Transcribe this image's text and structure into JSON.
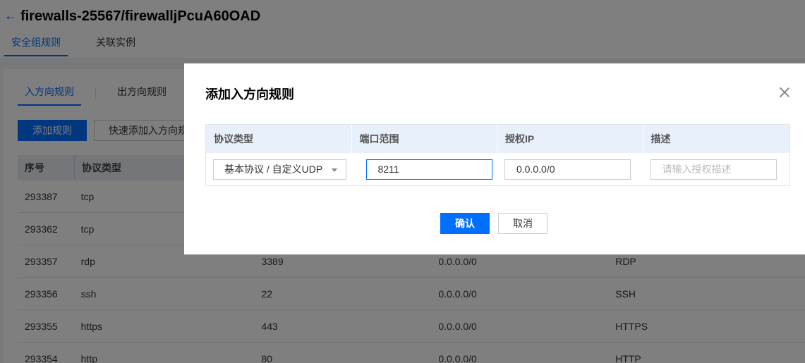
{
  "header": {
    "title": "firewalls-25567/firewalljPcuA60OAD",
    "back_icon": "←",
    "tabs": [
      {
        "label": "安全组规则"
      },
      {
        "label": "关联实例"
      }
    ]
  },
  "rules": {
    "sub_tabs": [
      {
        "label": "入方向规则"
      },
      {
        "label": "出方向规则"
      }
    ],
    "add_button": "添加规则",
    "quick_add_button": "快速添加入方向规",
    "columns": [
      "序号",
      "协议类型"
    ],
    "rows": [
      {
        "id": "293387",
        "protocol": "tcp",
        "port": "",
        "ip": "",
        "desc": ""
      },
      {
        "id": "293362",
        "protocol": "tcp",
        "port": "",
        "ip": "",
        "desc": ""
      },
      {
        "id": "293357",
        "protocol": "rdp",
        "port": "3389",
        "ip": "0.0.0.0/0",
        "desc": "RDP"
      },
      {
        "id": "293356",
        "protocol": "ssh",
        "port": "22",
        "ip": "0.0.0.0/0",
        "desc": "SSH"
      },
      {
        "id": "293355",
        "protocol": "https",
        "port": "443",
        "ip": "0.0.0.0/0",
        "desc": "HTTPS"
      },
      {
        "id": "293354",
        "protocol": "http",
        "port": "80",
        "ip": "0.0.0.0/0",
        "desc": "HTTP"
      }
    ]
  },
  "modal": {
    "title": "添加入方向规则",
    "columns": [
      "协议类型",
      "端口范围",
      "授权IP",
      "描述"
    ],
    "protocol_value": "基本协议 / 自定义UDP",
    "port_value": "8211",
    "ip_value": "0.0.0.0/0",
    "desc_placeholder": "请输入授权描述",
    "confirm_label": "确认",
    "cancel_label": "取消"
  },
  "colors": {
    "accent": "#006eff",
    "overlay": "rgba(0,0,0,0.5)"
  }
}
